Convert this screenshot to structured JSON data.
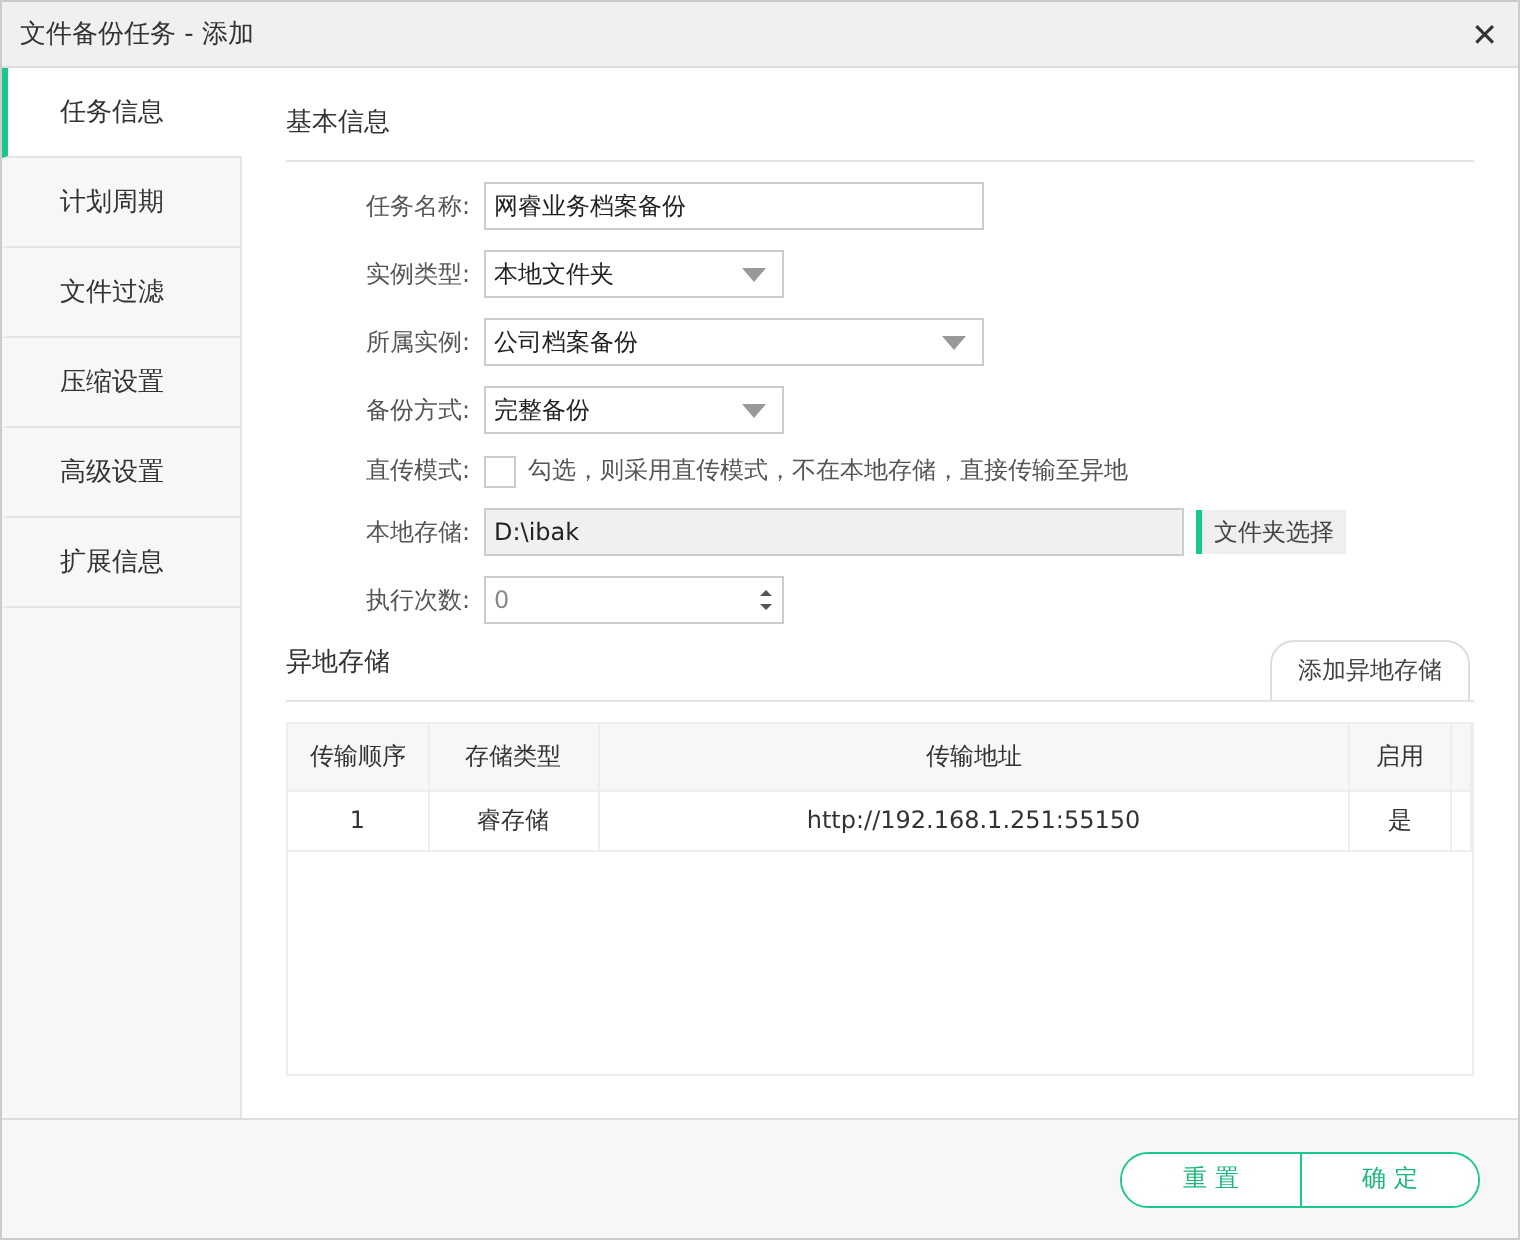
{
  "window": {
    "title": "文件备份任务 - 添加",
    "close": "✕"
  },
  "sidebar": {
    "items": [
      {
        "label": "任务信息",
        "selected": true
      },
      {
        "label": "计划周期",
        "selected": false
      },
      {
        "label": "文件过滤",
        "selected": false
      },
      {
        "label": "压缩设置",
        "selected": false
      },
      {
        "label": "高级设置",
        "selected": false
      },
      {
        "label": "扩展信息",
        "selected": false
      }
    ]
  },
  "basic_section": {
    "title": "基本信息",
    "fields": [
      {
        "kind": "text",
        "label": "任务名称:",
        "value": "网睿业务档案备份",
        "wide": true
      },
      {
        "kind": "select",
        "label": "实例类型:",
        "value": "本地文件夹",
        "wide": false
      },
      {
        "kind": "select",
        "label": "所属实例:",
        "value": "公司档案备份",
        "wide": true
      },
      {
        "kind": "select",
        "label": "备份方式:",
        "value": "完整备份",
        "wide": false
      },
      {
        "kind": "checkbox",
        "label": "直传模式:",
        "text": "勾选，则采用直传模式，不在本地存储，直接传输至异地",
        "checked": false
      },
      {
        "kind": "path",
        "label": "本地存储:",
        "value": "D:\\ibak",
        "button": "文件夹选择"
      },
      {
        "kind": "number",
        "label": "执行次数:",
        "value": "0"
      }
    ]
  },
  "remote_section": {
    "title": "异地存储",
    "add_button": "添加异地存储",
    "table": {
      "columns": [
        "传输顺序",
        "存储类型",
        "传输地址",
        "启用"
      ],
      "rows": [
        [
          "1",
          "睿存储",
          "http://192.168.1.251:55150",
          "是"
        ]
      ]
    }
  },
  "footer": {
    "buttons": [
      "重 置",
      "确 定"
    ]
  }
}
